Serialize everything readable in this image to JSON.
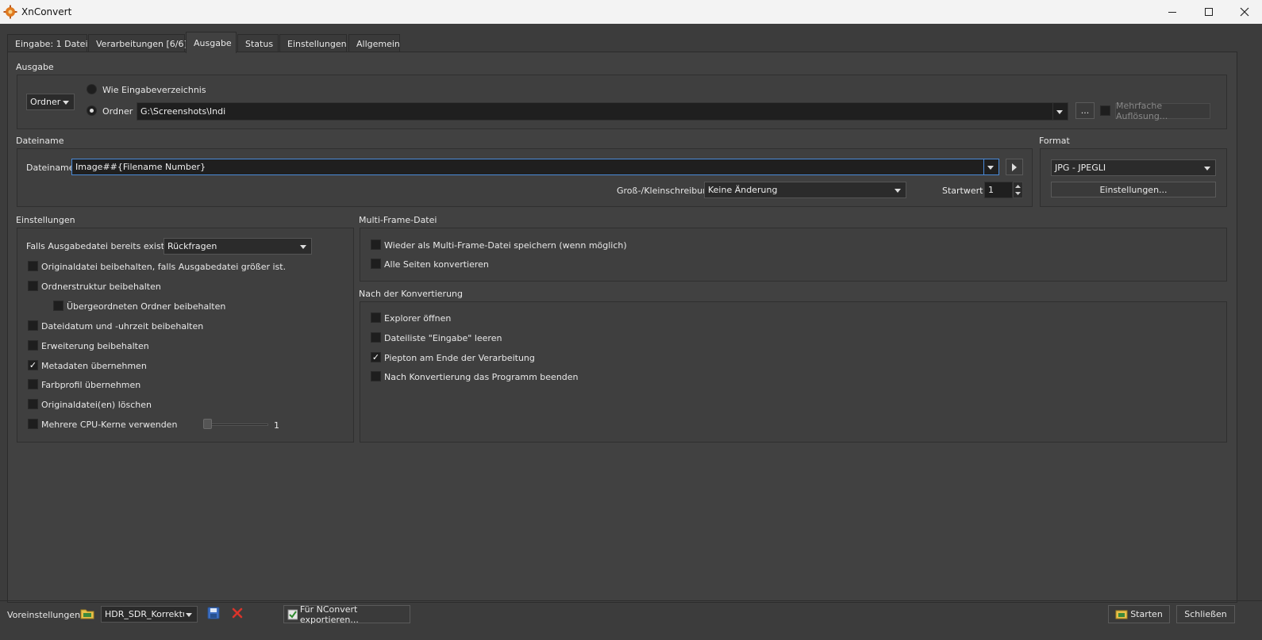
{
  "window": {
    "title": "XnConvert",
    "minimize_icon": "minimize-icon",
    "maximize_icon": "maximize-icon",
    "close_icon": "close-icon"
  },
  "tabs": [
    {
      "label": "Eingabe: 1 Datei"
    },
    {
      "label": "Verarbeitungen [6/6]"
    },
    {
      "label": "Ausgabe",
      "active": true
    },
    {
      "label": "Status"
    },
    {
      "label": "Einstellungen"
    },
    {
      "label": "Allgemein"
    }
  ],
  "ausgabe": {
    "group_label": "Ausgabe",
    "type_combo": "Ordner",
    "radio_same_dir": "Wie Eingabeverzeichnis",
    "radio_folder": "Ordner",
    "folder_path": "G:\\Screenshots\\Indi",
    "browse_button": "...",
    "multi_resolution": "Mehrfache Auflösung..."
  },
  "dateiname": {
    "group_label": "Dateiname",
    "field_label": "Dateiname",
    "value": "Image##{Filename Number}",
    "case_label": "Groß-/Kleinschreibung",
    "case_value": "Keine Änderung",
    "start_label": "Startwert",
    "start_value": "1"
  },
  "format": {
    "group_label": "Format",
    "value": "JPG - JPEGLI",
    "settings_button": "Einstellungen..."
  },
  "einstellungen": {
    "group_label": "Einstellungen",
    "exists_label": "Falls Ausgabedatei bereits existiert",
    "exists_value": "Rückfragen",
    "options": [
      {
        "label": "Originaldatei beibehalten, falls Ausgabedatei größer ist.",
        "checked": false
      },
      {
        "label": "Ordnerstruktur beibehalten",
        "checked": false
      },
      {
        "label": "Übergeordneten Ordner beibehalten",
        "checked": false
      },
      {
        "label": "Dateidatum und -uhrzeit beibehalten",
        "checked": false
      },
      {
        "label": "Erweiterung beibehalten",
        "checked": false
      },
      {
        "label": "Metadaten übernehmen",
        "checked": true
      },
      {
        "label": "Farbprofil übernehmen",
        "checked": false
      },
      {
        "label": "Originaldatei(en) löschen",
        "checked": false
      },
      {
        "label": "Mehrere CPU-Kerne verwenden",
        "checked": false
      }
    ],
    "cpu_cores_value": "1"
  },
  "multiframe": {
    "group_label": "Multi-Frame-Datei",
    "options": [
      {
        "label": "Wieder als Multi-Frame-Datei speichern (wenn möglich)",
        "checked": false
      },
      {
        "label": "Alle Seiten konvertieren",
        "checked": false
      }
    ]
  },
  "nach_konvertierung": {
    "group_label": "Nach der Konvertierung",
    "options": [
      {
        "label": "Explorer öffnen",
        "checked": false
      },
      {
        "label": "Dateiliste \"Eingabe\" leeren",
        "checked": false
      },
      {
        "label": "Piepton am Ende der Verarbeitung",
        "checked": true
      },
      {
        "label": "Nach Konvertierung das Programm beenden",
        "checked": false
      }
    ]
  },
  "bottom": {
    "presets_label": "Voreinstellungen:",
    "preset_value": "HDR_SDR_Korrektur",
    "export_button": "Für NConvert exportieren...",
    "start_button": "Starten",
    "close_button": "Schließen"
  },
  "colors": {
    "background": "#3c3c3c",
    "accent_focus": "#4a8ad8",
    "delete_red": "#d9342b"
  }
}
